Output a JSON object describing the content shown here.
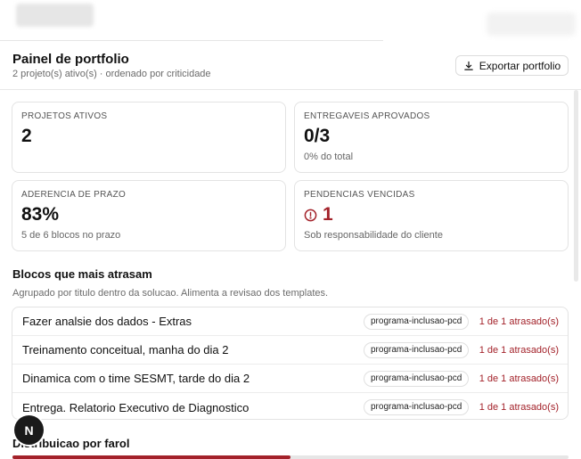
{
  "header": {
    "title": "Painel de portfolio",
    "subtitle": "2 projeto(s) ativo(s) · ordenado por criticidade",
    "export_label": "Exportar portfolio"
  },
  "cards": {
    "active_projects": {
      "label": "PROJETOS ATIVOS",
      "value": "2"
    },
    "approved": {
      "label": "ENTREGAVEIS APROVADOS",
      "value": "0/3",
      "note": "0% do total"
    },
    "deadline": {
      "label": "ADERENCIA DE PRAZO",
      "value": "83%",
      "note": "5 de 6 blocos no prazo"
    },
    "overdue": {
      "label": "PENDENCIAS VENCIDAS",
      "value": "1",
      "note": "Sob responsabilidade do cliente",
      "icon": "alert-circle-icon",
      "color": "#a3222a"
    }
  },
  "blocks": {
    "title": "Blocos que mais atrasam",
    "description": "Agrupado por titulo dentro da solucao. Alimenta a revisao dos templates.",
    "rows": [
      {
        "name": "Fazer analsie dos dados - Extras",
        "tag": "programa-inclusao-pcd",
        "late": "1 de 1 atrasado(s)"
      },
      {
        "name": "Treinamento conceitual, manha do dia 2",
        "tag": "programa-inclusao-pcd",
        "late": "1 de 1 atrasado(s)"
      },
      {
        "name": "Dinamica com o time SESMT, tarde do dia 2",
        "tag": "programa-inclusao-pcd",
        "late": "1 de 1 atrasado(s)"
      },
      {
        "name": "Entrega. Relatorio Executivo de Diagnostico",
        "tag": "programa-inclusao-pcd",
        "late": "1 de 1 atrasado(s)"
      }
    ]
  },
  "farol": {
    "title": "Distribuicao por farol"
  },
  "badge": {
    "letter": "N"
  },
  "colors": {
    "danger": "#a3222a",
    "border": "#e3e3e3",
    "muted": "#6b6b6b"
  }
}
